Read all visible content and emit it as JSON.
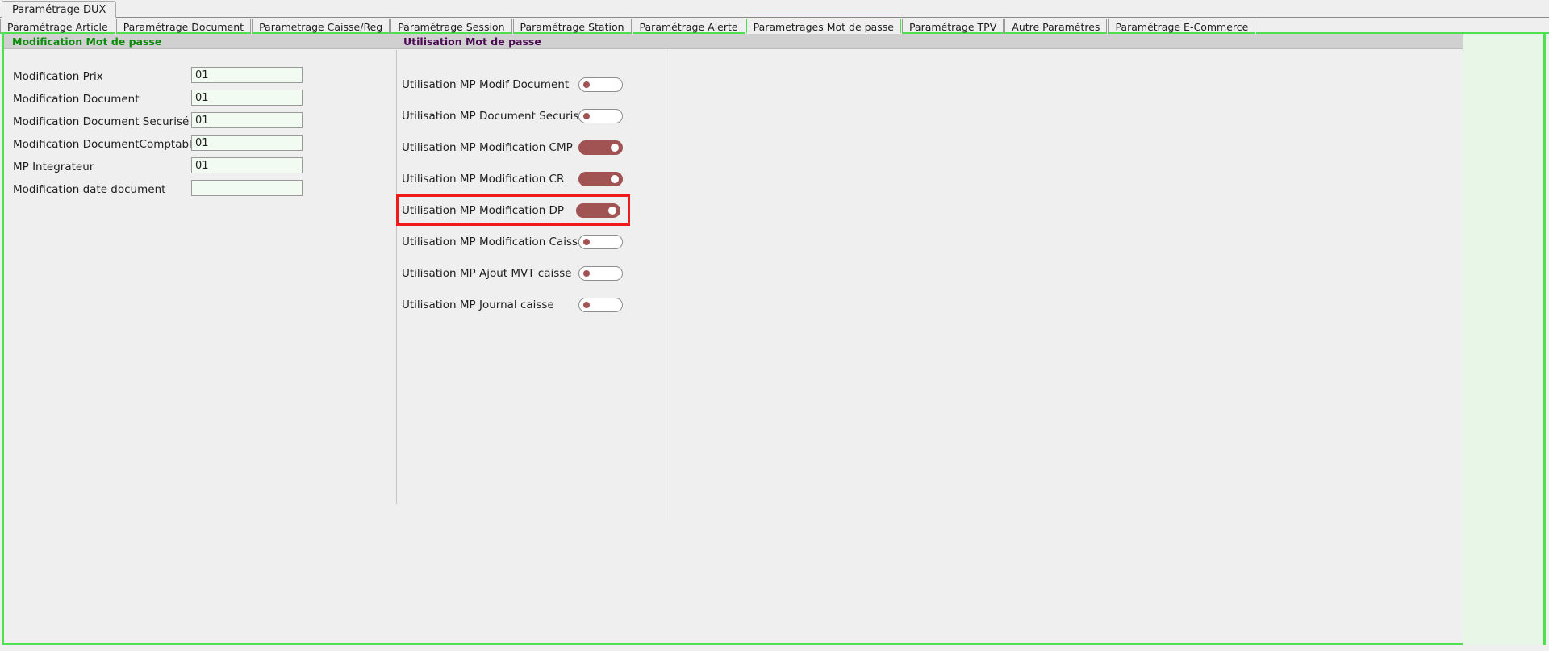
{
  "window": {
    "primary_tab": "Paramétrage DUX"
  },
  "tabs": [
    {
      "label": "Paramétrage Article",
      "active": false
    },
    {
      "label": "Paramétrage Document",
      "active": false
    },
    {
      "label": "Parametrage Caisse/Reg",
      "active": false
    },
    {
      "label": "Paramétrage Session",
      "active": false
    },
    {
      "label": "Paramétrage Station",
      "active": false
    },
    {
      "label": "Paramétrage Alerte",
      "active": false
    },
    {
      "label": "Parametrages Mot de passe",
      "active": true
    },
    {
      "label": "Paramétrage TPV",
      "active": false
    },
    {
      "label": "Autre Paramétres",
      "active": false
    },
    {
      "label": "Paramétrage E-Commerce",
      "active": false
    }
  ],
  "sections": {
    "left_title": "Modification Mot de passe",
    "right_title": "Utilisation Mot de passe"
  },
  "colors": {
    "left_title": "#0a8a0a",
    "right_title": "#4b0a52",
    "accent_frame": "#4fe04f",
    "toggle_on": "#a15252",
    "highlight_border": "#ef1b1b",
    "input_bg": "#f1fbf1",
    "header_band": "#d0d0d0"
  },
  "left_form": {
    "fields": [
      {
        "label": "Modification Prix",
        "value": "01",
        "placeholder": ""
      },
      {
        "label": "Modification Document",
        "value": "01",
        "placeholder": ""
      },
      {
        "label": "Modification Document Securisé",
        "value": "01",
        "placeholder": ""
      },
      {
        "label": "Modification DocumentComptable",
        "value": "01",
        "placeholder": ""
      },
      {
        "label": "MP Integrateur",
        "value": "01",
        "placeholder": ""
      },
      {
        "label": "Modification date document",
        "value": "",
        "placeholder": ""
      }
    ]
  },
  "right_toggles": {
    "items": [
      {
        "label": "Utilisation MP Modif Document",
        "state": "off",
        "highlighted": false
      },
      {
        "label": "Utilisation MP Document Securisé",
        "state": "off",
        "highlighted": false
      },
      {
        "label": "Utilisation MP Modification CMP",
        "state": "on",
        "highlighted": false
      },
      {
        "label": "Utilisation MP Modification CR",
        "state": "on",
        "highlighted": false
      },
      {
        "label": "Utilisation MP Modification DP",
        "state": "on",
        "highlighted": true
      },
      {
        "label": "Utilisation MP Modification Caisse",
        "state": "off",
        "highlighted": false
      },
      {
        "label": "Utilisation MP Ajout MVT caisse",
        "state": "off",
        "highlighted": false
      },
      {
        "label": "Utilisation MP Journal caisse",
        "state": "off",
        "highlighted": false
      }
    ]
  }
}
